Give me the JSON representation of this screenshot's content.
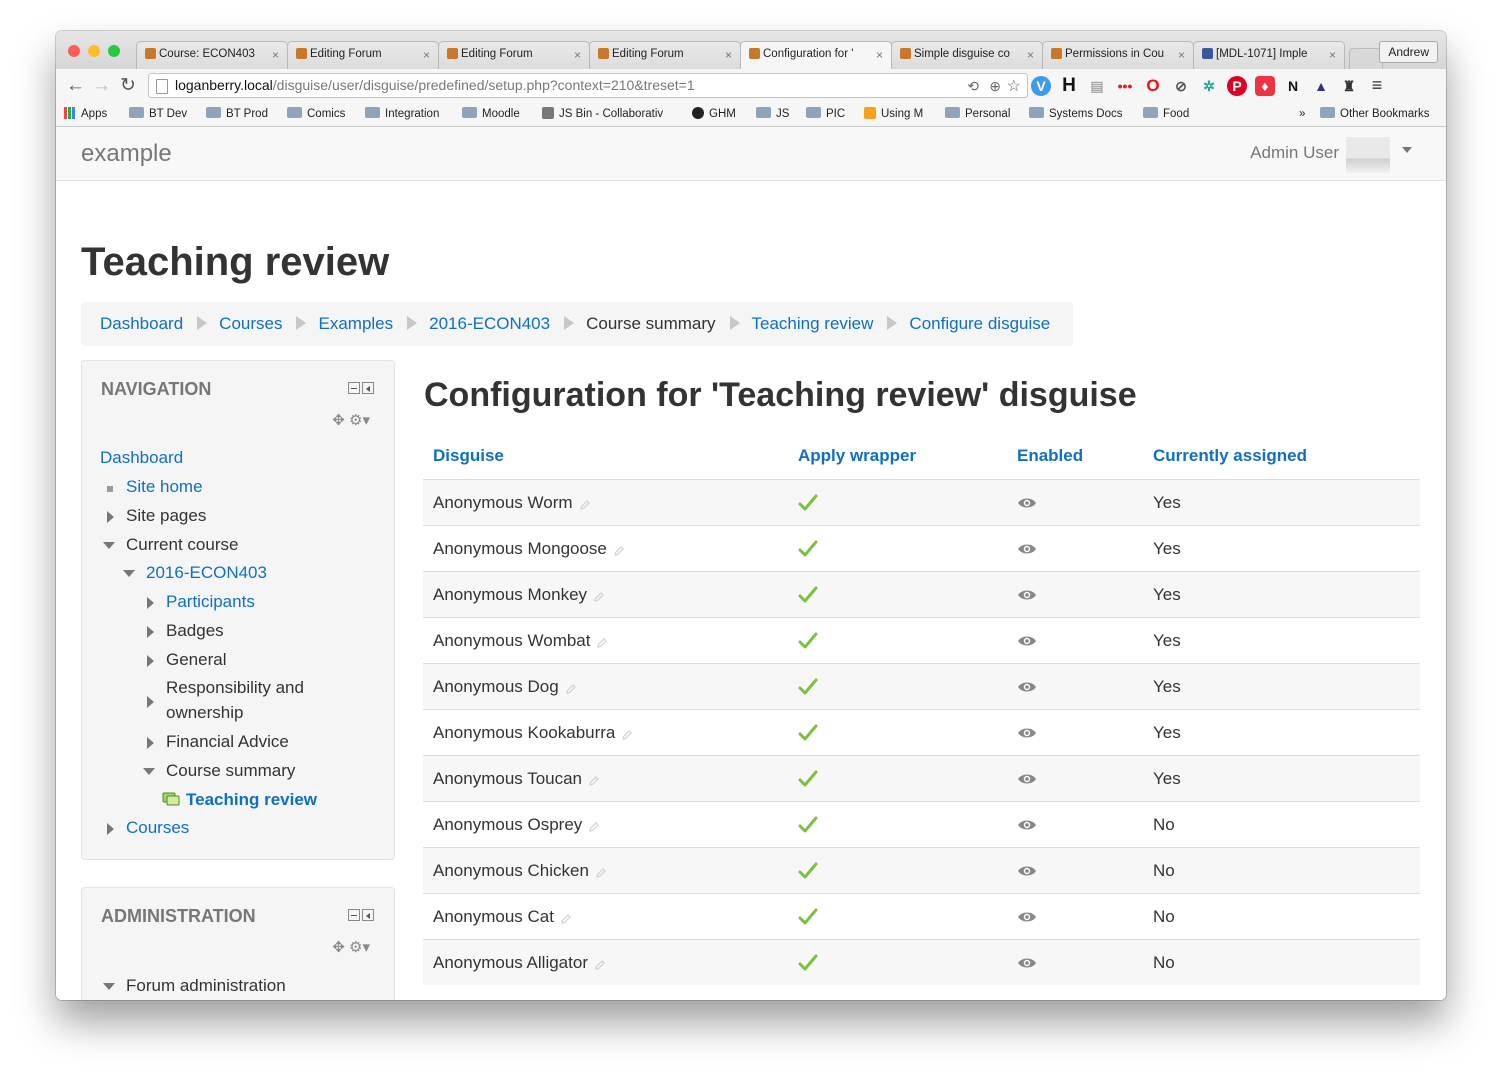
{
  "browser": {
    "tabs": [
      {
        "label": "Course: ECON403",
        "icon": "moodle-icon",
        "active": false
      },
      {
        "label": "Editing Forum",
        "icon": "moodle-icon",
        "active": false
      },
      {
        "label": "Editing Forum",
        "icon": "moodle-icon",
        "active": false
      },
      {
        "label": "Editing Forum",
        "icon": "moodle-icon",
        "active": false
      },
      {
        "label": "Configuration for '",
        "icon": "moodle-icon",
        "active": true
      },
      {
        "label": "Simple disguise co",
        "icon": "moodle-icon",
        "active": false
      },
      {
        "label": "Permissions in Cou",
        "icon": "moodle-icon",
        "active": false
      },
      {
        "label": "[MDL-1071] Imple",
        "icon": "jira-icon",
        "active": false
      }
    ],
    "profile": "Andrew",
    "url_host": "loganberry.local",
    "url_path": "/disguise/user/disguise/predefined/setup.php?context=210&treset=1",
    "bookmarks": [
      {
        "label": "Apps",
        "icon": "apps-grid-icon"
      },
      {
        "label": "BT Dev",
        "icon": "folder-icon"
      },
      {
        "label": "BT Prod",
        "icon": "folder-icon"
      },
      {
        "label": "Comics",
        "icon": "folder-icon"
      },
      {
        "label": "Integration",
        "icon": "folder-icon"
      },
      {
        "label": "Moodle",
        "icon": "folder-icon"
      },
      {
        "label": "JS Bin - Collaborativ",
        "icon": "jsbin-icon"
      },
      {
        "label": "GHM",
        "icon": "github-icon"
      },
      {
        "label": "JS",
        "icon": "folder-icon"
      },
      {
        "label": "PIC",
        "icon": "folder-icon"
      },
      {
        "label": "Using M",
        "icon": "moodle-icon"
      },
      {
        "label": "Personal",
        "icon": "folder-icon"
      },
      {
        "label": "Systems Docs",
        "icon": "folder-icon"
      },
      {
        "label": "Food",
        "icon": "folder-icon"
      }
    ],
    "bookmarks_overflow": "»",
    "other_bookmarks": "Other Bookmarks"
  },
  "site": {
    "brand": "example",
    "user_name": "Admin User"
  },
  "page_title": "Teaching review",
  "breadcrumb": [
    {
      "label": "Dashboard",
      "link": true
    },
    {
      "label": "Courses",
      "link": true
    },
    {
      "label": "Examples",
      "link": true
    },
    {
      "label": "2016-ECON403",
      "link": true
    },
    {
      "label": "Course summary",
      "link": false
    },
    {
      "label": "Teaching review",
      "link": true
    },
    {
      "label": "Configure disguise",
      "link": true
    }
  ],
  "navigation_block": {
    "title": "NAVIGATION",
    "items": [
      {
        "label": "Dashboard"
      },
      {
        "label": "Site home"
      },
      {
        "label": "Site pages"
      },
      {
        "label": "Current course"
      },
      {
        "label": "2016-ECON403"
      },
      {
        "label": "Participants"
      },
      {
        "label": "Badges"
      },
      {
        "label": "General"
      },
      {
        "label": "Responsibility and"
      },
      {
        "label": "ownership"
      },
      {
        "label": "Financial Advice"
      },
      {
        "label": "Course summary"
      },
      {
        "label": "Teaching review"
      },
      {
        "label": "Courses"
      }
    ]
  },
  "administration_block": {
    "title": "ADMINISTRATION",
    "items": [
      {
        "label": "Forum administration"
      }
    ]
  },
  "main": {
    "heading": "Configuration for 'Teaching review' disguise",
    "columns": [
      "Disguise",
      "Apply wrapper",
      "Enabled",
      "Currently assigned"
    ],
    "rows": [
      {
        "name": "Anonymous Worm",
        "assigned": "Yes"
      },
      {
        "name": "Anonymous Mongoose",
        "assigned": "Yes"
      },
      {
        "name": "Anonymous Monkey",
        "assigned": "Yes"
      },
      {
        "name": "Anonymous Wombat",
        "assigned": "Yes"
      },
      {
        "name": "Anonymous Dog",
        "assigned": "Yes"
      },
      {
        "name": "Anonymous Kookaburra",
        "assigned": "Yes"
      },
      {
        "name": "Anonymous Toucan",
        "assigned": "Yes"
      },
      {
        "name": "Anonymous Osprey",
        "assigned": "No"
      },
      {
        "name": "Anonymous Chicken",
        "assigned": "No"
      },
      {
        "name": "Anonymous Cat",
        "assigned": "No"
      },
      {
        "name": "Anonymous Alligator",
        "assigned": "No"
      }
    ]
  },
  "colors": {
    "link": "#0f6fc5",
    "check": "#7ac142",
    "breadcrumb_bg": "#f5f5f5"
  }
}
